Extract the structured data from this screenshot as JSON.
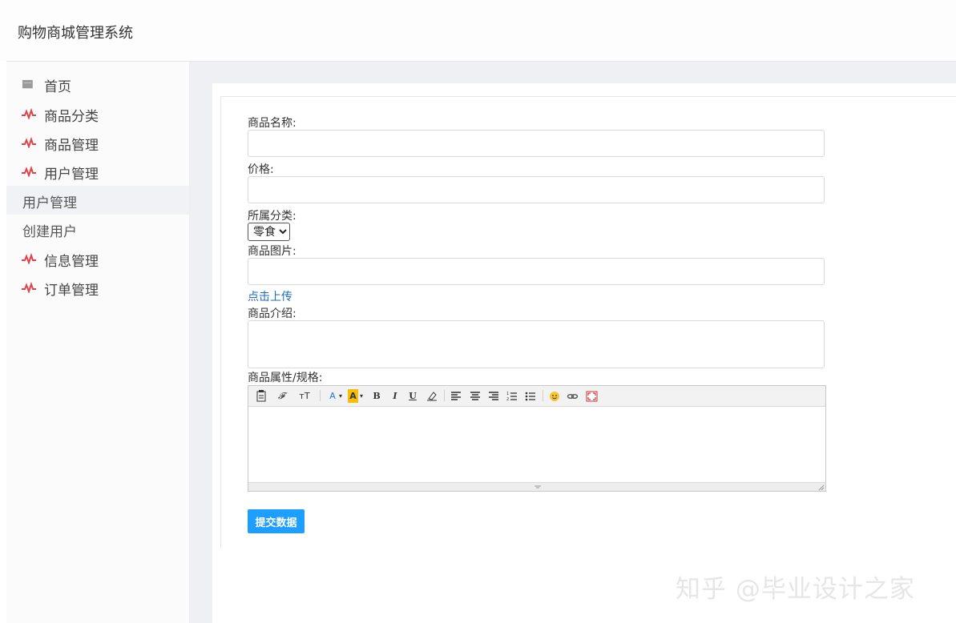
{
  "app": {
    "title": "购物商城管理系统"
  },
  "sidebar": {
    "items": [
      {
        "label": "首页",
        "icon": "home-icon"
      },
      {
        "label": "商品分类",
        "icon": "pulse-icon"
      },
      {
        "label": "商品管理",
        "icon": "pulse-icon"
      },
      {
        "label": "用户管理",
        "icon": "pulse-icon"
      },
      {
        "label": "用户管理",
        "icon": ""
      },
      {
        "label": "创建用户",
        "icon": ""
      },
      {
        "label": "信息管理",
        "icon": "pulse-icon"
      },
      {
        "label": "订单管理",
        "icon": "pulse-icon"
      }
    ]
  },
  "form": {
    "name_label": "商品名称:",
    "name_value": "",
    "price_label": "价格:",
    "price_value": "",
    "category_label": "所属分类:",
    "category_selected": "零食",
    "image_label": "商品图片:",
    "image_value": "",
    "upload_link": "点击上传",
    "intro_label": "商品介绍:",
    "intro_value": "",
    "spec_label": "商品属性/规格:",
    "submit_label": "提交数据"
  },
  "editor": {
    "toolbar": {
      "fontface": "𝓕",
      "fontsize": "тT",
      "fontcolor": "A",
      "bgcolor": "A",
      "bold": "B",
      "italic": "I",
      "underline": "U"
    }
  },
  "colors": {
    "accent": "#1e9fff",
    "link": "#1e6fbf",
    "menu_icon": "#e0414b"
  },
  "watermark": "知乎 @毕业设计之家"
}
